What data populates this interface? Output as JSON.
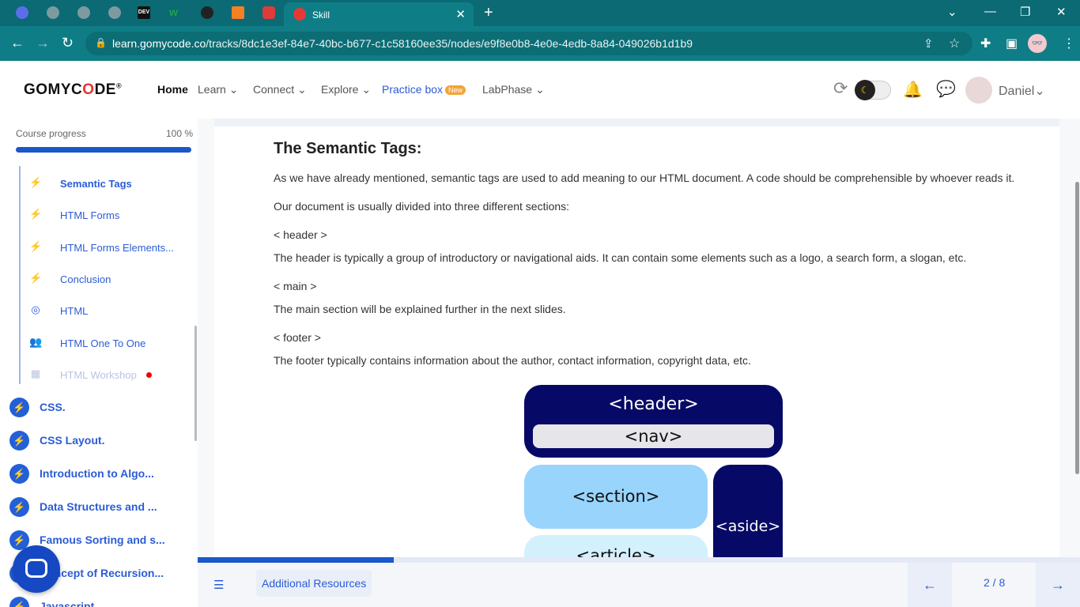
{
  "browser": {
    "active_tab": {
      "title": "Skill"
    },
    "tabs": [
      {
        "icon": "app-icon",
        "color": "#5b6ee8"
      },
      {
        "icon": "globe-icon",
        "color": "#7d9aa0"
      },
      {
        "icon": "globe-icon",
        "color": "#7d9aa0"
      },
      {
        "icon": "globe-icon",
        "color": "#7d9aa0"
      },
      {
        "icon": "dev-icon",
        "label": "DEV",
        "color": "#111111"
      },
      {
        "icon": "w-icon",
        "label": "w",
        "color": "#1aa34a"
      },
      {
        "icon": "github-icon",
        "color": "#222222"
      },
      {
        "icon": "stack-icon",
        "color": "#f48024"
      },
      {
        "icon": "shield-icon",
        "color": "#e03b3b"
      }
    ],
    "url_domain": "learn.gomycode.co",
    "url_path": "/tracks/8dc1e3ef-84e7-40bc-b677-c1c58160ee35/nodes/e9f8e0b8-4e0e-4edb-8a84-049026b1d1b9"
  },
  "app": {
    "logo_left": "GOMYC",
    "logo_o": "O",
    "logo_right": "DE",
    "logo_mark": "®",
    "nav": {
      "home": "Home",
      "learn": "Learn",
      "connect": "Connect",
      "explore": "Explore",
      "practice": "Practice box",
      "practice_badge": "New",
      "labphase": "LabPhase"
    },
    "user": {
      "name": "Daniel"
    }
  },
  "sidebar": {
    "progress_label": "Course progress",
    "progress_value": "100 %",
    "progress_fraction": 1.0,
    "sub_items": [
      {
        "label": "Semantic Tags",
        "icon": "bolt-icon",
        "active": true
      },
      {
        "label": "HTML Forms",
        "icon": "bolt-icon"
      },
      {
        "label": "HTML Forms Elements...",
        "icon": "bolt-icon"
      },
      {
        "label": "Conclusion",
        "icon": "bolt-icon"
      },
      {
        "label": "HTML",
        "icon": "target-icon"
      },
      {
        "label": "HTML One To One",
        "icon": "people-icon"
      },
      {
        "label": "HTML Workshop",
        "icon": "workshop-icon",
        "dim": true
      }
    ],
    "modules": [
      {
        "label": "CSS."
      },
      {
        "label": "CSS Layout."
      },
      {
        "label": "Introduction to Algo..."
      },
      {
        "label": "Data Structures and ..."
      },
      {
        "label": "Famous Sorting and s..."
      },
      {
        "label": "Concept of Recursion..."
      },
      {
        "label": "Javascript"
      }
    ]
  },
  "content": {
    "title": "The Semantic Tags:",
    "paragraphs": [
      "As we have already mentioned, semantic tags are used to add meaning to our HTML document. A code should be comprehensible by whoever reads it.",
      "Our document is usually divided into three different sections:",
      "< header >",
      "The header is typically a group of introductory or navigational aids. It can contain some elements such as a logo, a search form, a slogan, etc.",
      "< main >",
      "The main section will be explained further in the next slides.",
      "< footer >",
      "The footer typically contains information about the author, contact information, copyright data, etc."
    ],
    "diagram": {
      "header": "<header>",
      "nav": "<nav>",
      "section": "<section>",
      "aside": "<aside>",
      "article": "<article>",
      "colors": {
        "dark": "#060a66",
        "nav": "#e6e6ea",
        "section": "#98d4fb",
        "article": "#d3f0fd"
      }
    }
  },
  "footer": {
    "lesson_progress_fraction": 0.222,
    "additional_resources": "Additional Resources",
    "pager": "2 / 8"
  }
}
